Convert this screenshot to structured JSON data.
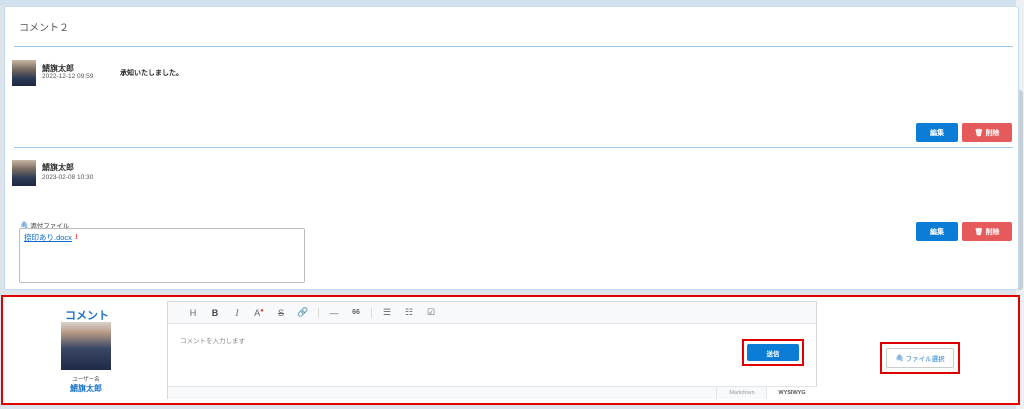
{
  "card": {
    "title": "コメント２",
    "comments": [
      {
        "author": "鯖旗太郎",
        "date": "2022-12-12 09:59",
        "text": "承知いたしました。",
        "edit_label": "編集",
        "delete_label": "削除"
      },
      {
        "author": "鯖旗太郎",
        "date": "2023-02-08 10:30",
        "attachment_label": "添付ファイル",
        "attachment_file": "捺印あり.docx",
        "edit_label": "編集",
        "delete_label": "削除"
      }
    ]
  },
  "comment_form": {
    "title": "コメント",
    "username_label": "ユーザー名",
    "username": "鯖旗太郎",
    "placeholder": "コメントを入力します",
    "send_label": "送信",
    "mode_markdown": "Markdown",
    "mode_wysiwyg": "WYSIWYG",
    "file_select_label": "ファイル選択",
    "toolbar": [
      "H",
      "B",
      "I",
      "A",
      "S",
      "🔗",
      "—",
      "66",
      "☰",
      "☷",
      "☑"
    ]
  },
  "colors": {
    "accent": "#0b7dd6",
    "danger": "#e55b5b",
    "highlight": "#e00000",
    "title_blue": "#1a74c9"
  }
}
